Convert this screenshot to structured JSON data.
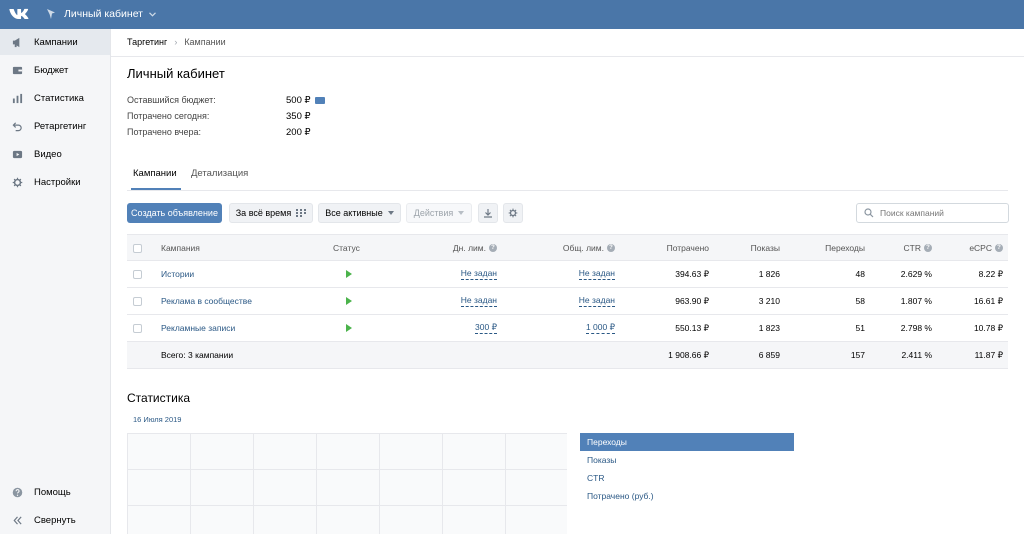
{
  "header": {
    "account": "Личный кабинет"
  },
  "sidebar": {
    "items": [
      {
        "label": "Кампании"
      },
      {
        "label": "Бюджет"
      },
      {
        "label": "Статистика"
      },
      {
        "label": "Ретаргетинг"
      },
      {
        "label": "Видео"
      },
      {
        "label": "Настройки"
      }
    ],
    "bottom": [
      {
        "label": "Помощь"
      },
      {
        "label": "Свернуть"
      }
    ]
  },
  "breadcrumb": {
    "root": "Таргетинг",
    "current": "Кампании"
  },
  "page": {
    "title": "Личный кабинет"
  },
  "budget": [
    {
      "label": "Оставшийся бюджет:",
      "value": "500 ₽"
    },
    {
      "label": "Потрачено сегодня:",
      "value": "350 ₽"
    },
    {
      "label": "Потрачено вчера:",
      "value": "200 ₽"
    }
  ],
  "tabs": [
    {
      "label": "Кампании"
    },
    {
      "label": "Детализация"
    }
  ],
  "toolbar": {
    "create": "Создать объявление",
    "period": "За всё время",
    "filter": "Все активные",
    "actions": "Действия",
    "search_placeholder": "Поиск кампаний"
  },
  "table": {
    "headers": {
      "name": "Кампания",
      "status": "Статус",
      "daily": "Дн. лим.",
      "total": "Общ. лим.",
      "spent": "Потрачено",
      "shows": "Показы",
      "clicks": "Переходы",
      "ctr": "CTR",
      "ecpc": "eCPC"
    },
    "rows": [
      {
        "name": "Истории",
        "daily": "Не задан",
        "total": "Не задан",
        "spent": "394.63 ₽",
        "shows": "1 826",
        "clicks": "48",
        "ctr": "2.629 %",
        "ecpc": "8.22 ₽"
      },
      {
        "name": "Реклама в сообществе",
        "daily": "Не задан",
        "total": "Не задан",
        "spent": "963.90 ₽",
        "shows": "3 210",
        "clicks": "58",
        "ctr": "1.807 %",
        "ecpc": "16.61 ₽"
      },
      {
        "name": "Рекламные записи",
        "daily": "300 ₽",
        "total": "1 000 ₽",
        "spent": "550.13 ₽",
        "shows": "1 823",
        "clicks": "51",
        "ctr": "2.798 %",
        "ecpc": "10.78 ₽"
      }
    ],
    "total": {
      "label": "Всего: 3 кампании",
      "spent": "1 908.66 ₽",
      "shows": "6 859",
      "clicks": "157",
      "ctr": "2.411 %",
      "ecpc": "11.87 ₽"
    }
  },
  "stats": {
    "title": "Статистика",
    "date": "16 Июля 2019",
    "metrics": [
      {
        "label": "Переходы"
      },
      {
        "label": "Показы"
      },
      {
        "label": "CTR"
      },
      {
        "label": "Потрачено (руб.)"
      }
    ]
  },
  "colors": {
    "header": "#4a76a8",
    "accent": "#5181b8",
    "link": "#2a5885",
    "status_active": "#4bb34b"
  }
}
